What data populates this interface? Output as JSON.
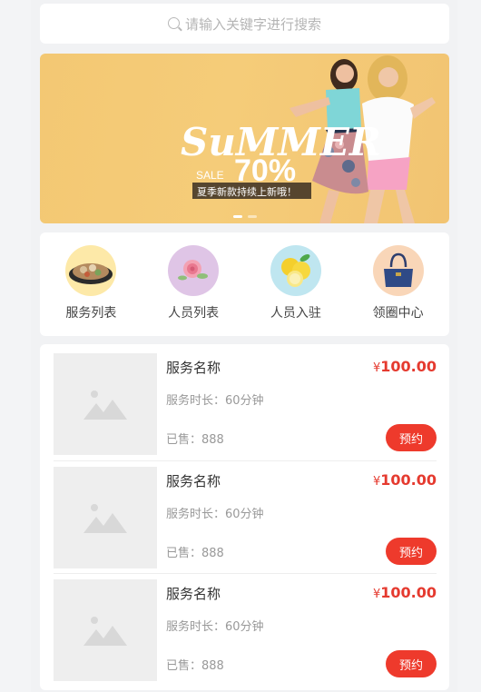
{
  "search": {
    "placeholder": "请输入关键字进行搜索"
  },
  "banner": {
    "headline": "SuMMER",
    "sale_word": "SALE",
    "discount": "70%",
    "caption": "夏季新款持续上新哦！"
  },
  "nav": {
    "items": [
      {
        "label": "服务列表",
        "icon": "food-platter-icon"
      },
      {
        "label": "人员列表",
        "icon": "rose-icon"
      },
      {
        "label": "人员入驻",
        "icon": "lemon-icon"
      },
      {
        "label": "领圈中心",
        "icon": "handbag-icon"
      }
    ]
  },
  "services": [
    {
      "name": "服务名称",
      "currency": "¥",
      "price": "100.00",
      "duration": "服务时长：60分钟",
      "sold": "已售：888",
      "button": "预约"
    },
    {
      "name": "服务名称",
      "currency": "¥",
      "price": "100.00",
      "duration": "服务时长：60分钟",
      "sold": "已售：888",
      "button": "预约"
    },
    {
      "name": "服务名称",
      "currency": "¥",
      "price": "100.00",
      "duration": "服务时长：60分钟",
      "sold": "已售：888",
      "button": "预约"
    }
  ],
  "colors": {
    "accent": "#ee3a2c",
    "price": "#e53a2f",
    "banner_bg": "#f4c977"
  }
}
